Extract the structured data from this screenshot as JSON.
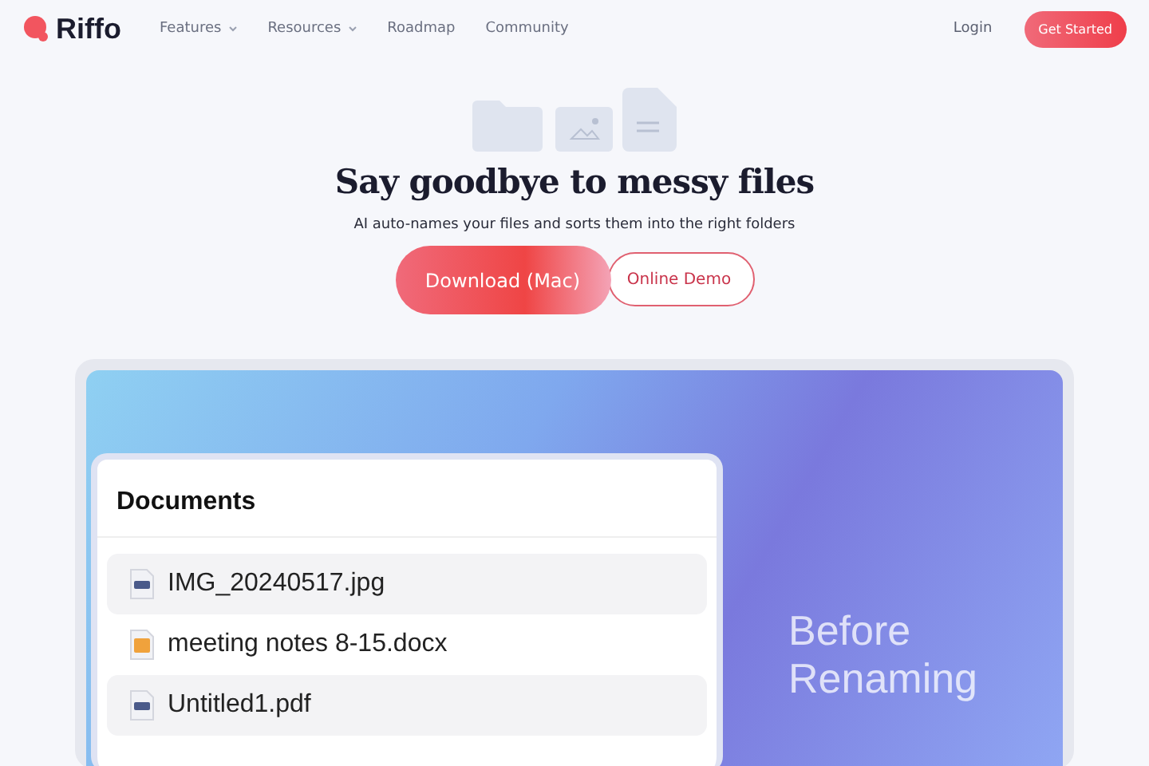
{
  "nav": {
    "brand": "Riffo",
    "links": [
      {
        "label": "Features",
        "dropdown": true
      },
      {
        "label": "Resources",
        "dropdown": true
      },
      {
        "label": "Roadmap",
        "dropdown": false
      },
      {
        "label": "Community",
        "dropdown": false
      }
    ],
    "login": "Login",
    "cta": "Get Started"
  },
  "hero": {
    "title": "Say goodbye to messy files",
    "subtitle": "AI auto-names your files and sorts them into the right folders",
    "primary": "Download (Mac)",
    "secondary": "Online Demo"
  },
  "showcase": {
    "panel_title": "Documents",
    "caption": "Before Renaming",
    "files": [
      {
        "name": "IMG_20240517.jpg",
        "kind": "image",
        "highlighted": true
      },
      {
        "name": "meeting notes 8-15.docx",
        "kind": "note",
        "highlighted": false
      },
      {
        "name": "Untitled1.pdf",
        "kind": "image",
        "highlighted": true
      }
    ]
  }
}
